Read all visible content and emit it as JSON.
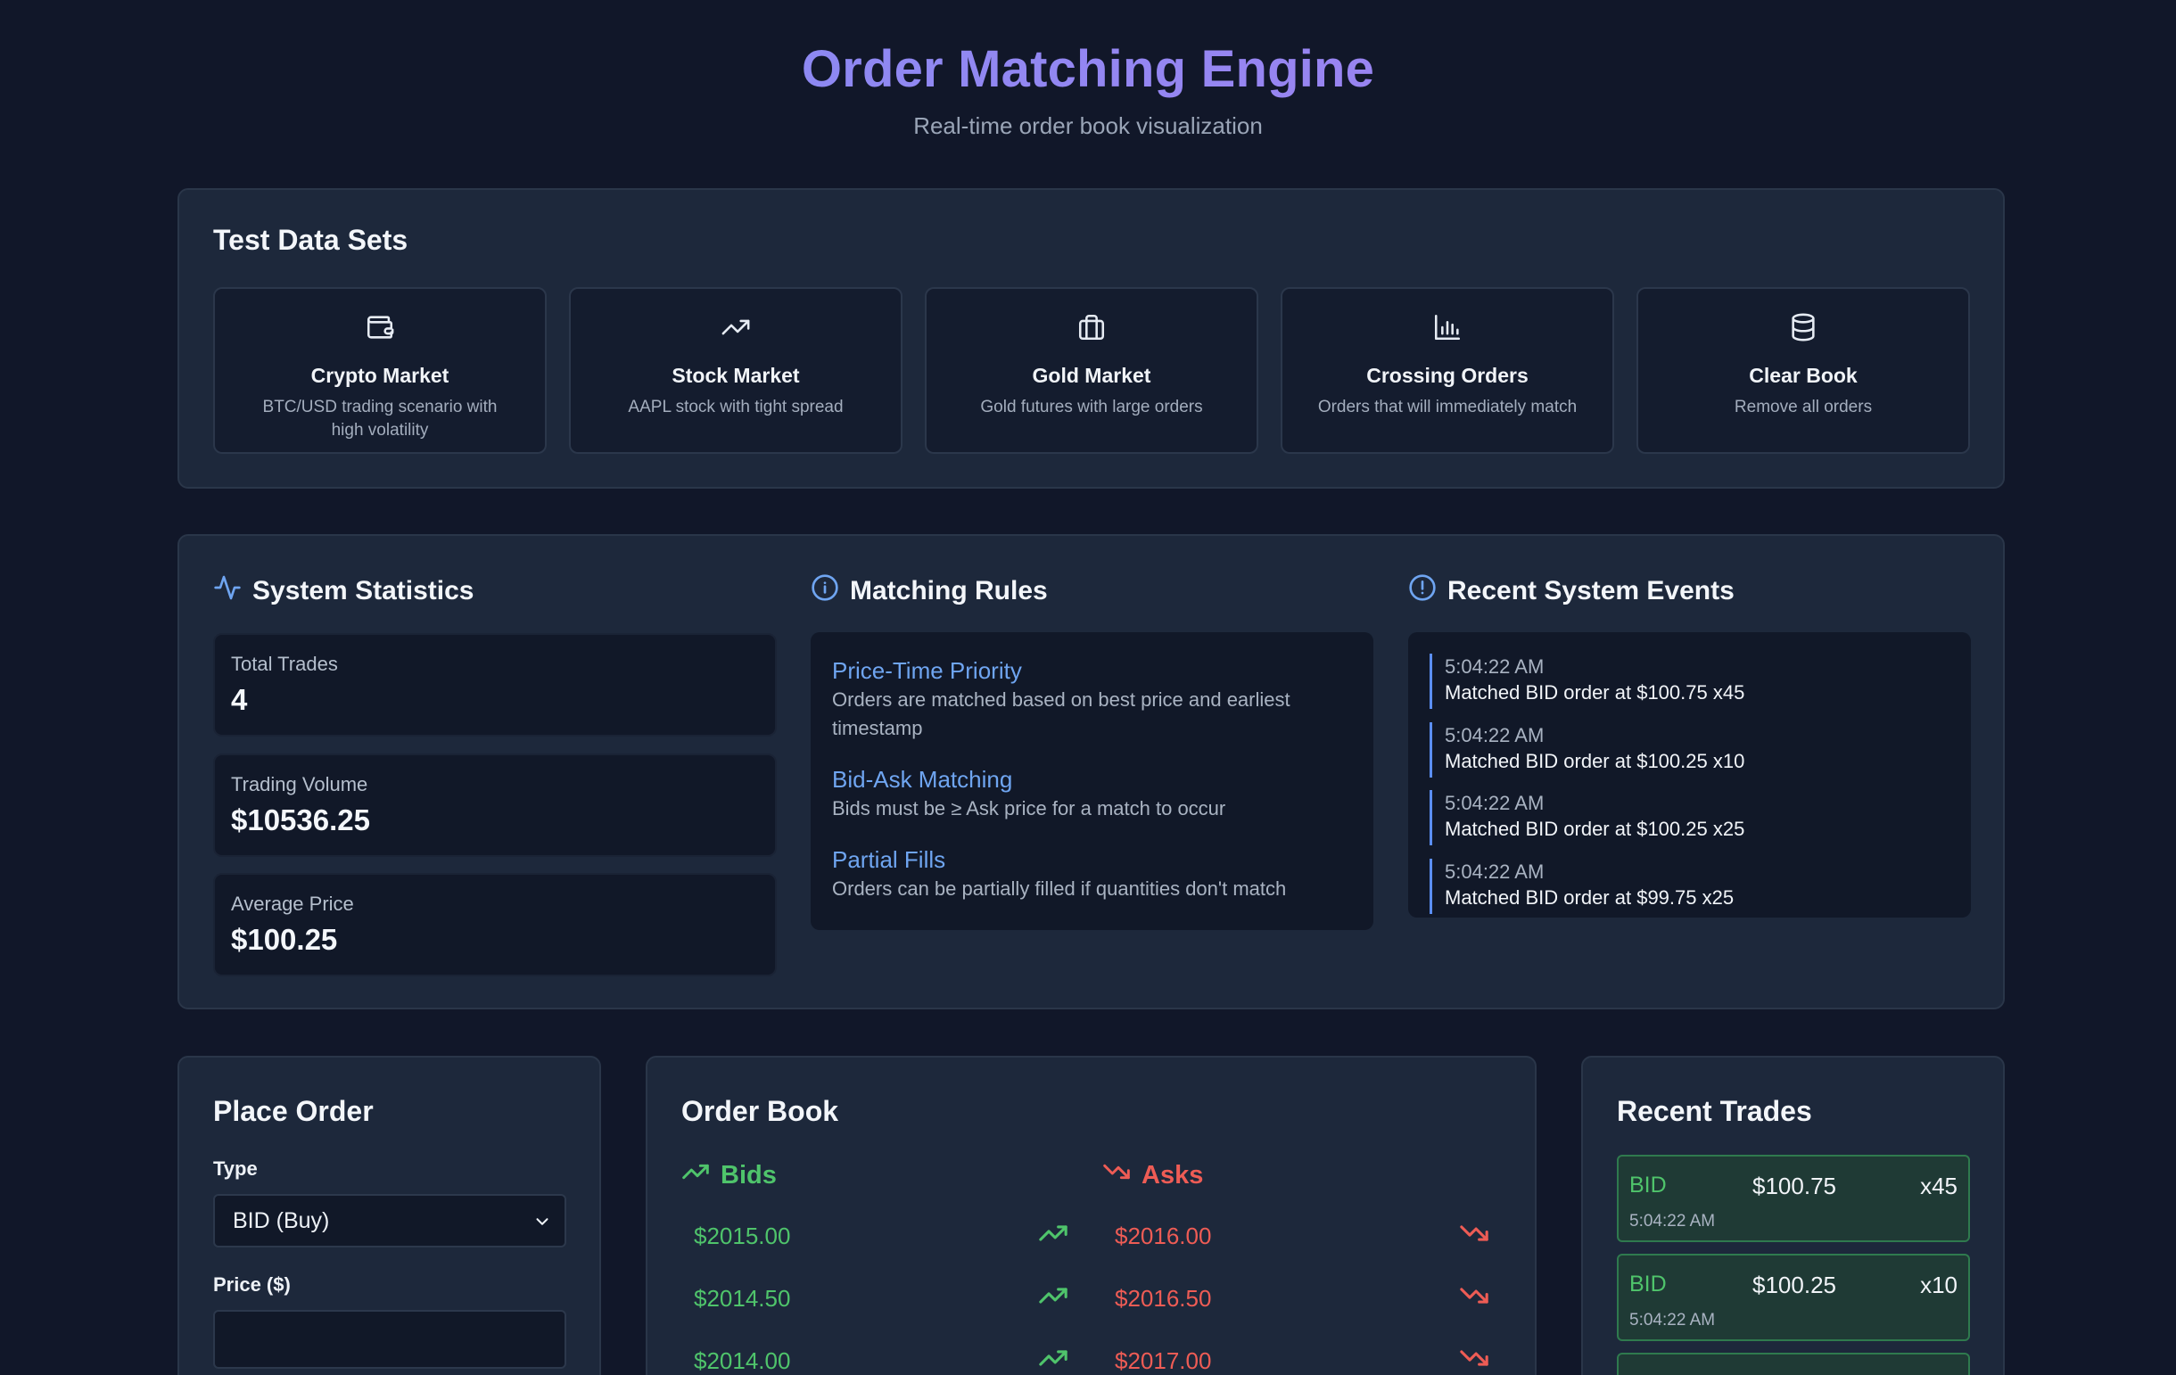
{
  "header": {
    "title": "Order Matching Engine",
    "subtitle": "Real-time order book visualization"
  },
  "datasets": {
    "title": "Test Data Sets",
    "items": [
      {
        "name": "Crypto Market",
        "desc": "BTC/USD trading scenario with high volatility",
        "icon": "wallet-icon"
      },
      {
        "name": "Stock Market",
        "desc": "AAPL stock with tight spread",
        "icon": "trending-up-icon"
      },
      {
        "name": "Gold Market",
        "desc": "Gold futures with large orders",
        "icon": "briefcase-icon"
      },
      {
        "name": "Crossing Orders",
        "desc": "Orders that will immediately match",
        "icon": "bar-chart-icon"
      },
      {
        "name": "Clear Book",
        "desc": "Remove all orders",
        "icon": "database-icon"
      }
    ]
  },
  "stats": {
    "title": "System Statistics",
    "items": [
      {
        "label": "Total Trades",
        "value": "4"
      },
      {
        "label": "Trading Volume",
        "value": "$10536.25"
      },
      {
        "label": "Average Price",
        "value": "$100.25"
      }
    ]
  },
  "rules": {
    "title": "Matching Rules",
    "items": [
      {
        "title": "Price-Time Priority",
        "desc": "Orders are matched based on best price and earliest timestamp"
      },
      {
        "title": "Bid-Ask Matching",
        "desc": "Bids must be ≥ Ask price for a match to occur"
      },
      {
        "title": "Partial Fills",
        "desc": "Orders can be partially filled if quantities don't match"
      }
    ]
  },
  "events": {
    "title": "Recent System Events",
    "items": [
      {
        "time": "5:04:22 AM",
        "msg": "Matched BID order at $100.75 x45"
      },
      {
        "time": "5:04:22 AM",
        "msg": "Matched BID order at $100.25 x10"
      },
      {
        "time": "5:04:22 AM",
        "msg": "Matched BID order at $100.25 x25"
      },
      {
        "time": "5:04:22 AM",
        "msg": "Matched BID order at $99.75 x25"
      }
    ]
  },
  "place_order": {
    "title": "Place Order",
    "type_label": "Type",
    "type_value": "BID (Buy)",
    "price_label": "Price ($)"
  },
  "order_book": {
    "title": "Order Book",
    "bids_label": "Bids",
    "asks_label": "Asks",
    "bids": [
      "$2015.00",
      "$2014.50",
      "$2014.00"
    ],
    "asks": [
      "$2016.00",
      "$2016.50",
      "$2017.00"
    ]
  },
  "recent_trades": {
    "title": "Recent Trades",
    "items": [
      {
        "side": "BID",
        "price": "$100.75",
        "qty": "x45",
        "time": "5:04:22 AM"
      },
      {
        "side": "BID",
        "price": "$100.25",
        "qty": "x10",
        "time": "5:04:22 AM"
      }
    ]
  },
  "colors": {
    "background": "#111729",
    "panel": "#1d283b",
    "accent_blue": "#6fa5f1",
    "bid_green": "#4fc46b",
    "ask_red": "#ee5c55"
  }
}
